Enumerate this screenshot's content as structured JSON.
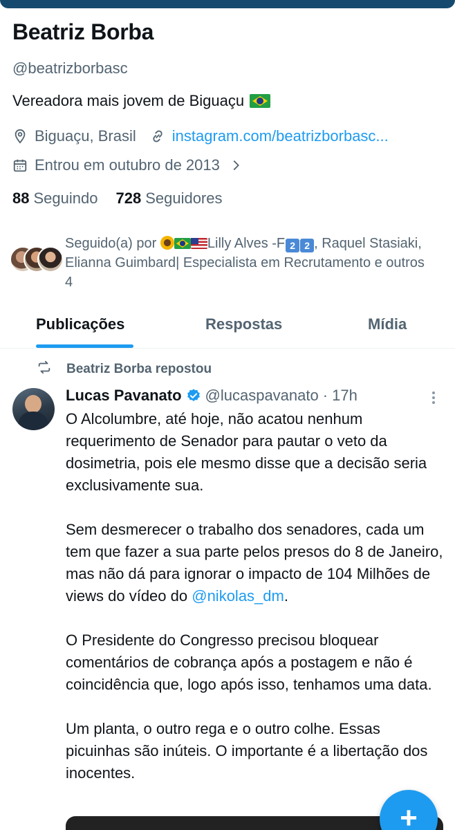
{
  "profile": {
    "name": "Beatriz Borba",
    "handle": "@beatrizborbasc",
    "bio": "Vereadora mais jovem de Biguaçu",
    "location": "Biguaçu, Brasil",
    "website": "instagram.com/beatrizborbasc...",
    "joined": "Entrou em outubro de 2013",
    "following_count": "88",
    "following_label": "Seguindo",
    "followers_count": "728",
    "followers_label": "Seguidores"
  },
  "followed_by": {
    "prefix": "Seguido(a) por",
    "name1": "Lilly Alves -F",
    "kbox": [
      "2",
      "2"
    ],
    "rest": ", Raquel Stasiaki, Elianna Guimbard| Especialista em Recrutamento e outros 4"
  },
  "tabs": [
    {
      "label": "Publicações",
      "active": true
    },
    {
      "label": "Respostas",
      "active": false
    },
    {
      "label": "Mídia",
      "active": false
    }
  ],
  "post": {
    "repost_text": "Beatriz Borba repostou",
    "author": "Lucas Pavanato",
    "handle": "@lucaspavanato",
    "time": "· 17h",
    "paragraphs": [
      "O Alcolumbre, até hoje, não acatou nenhum requerimento de Senador para pautar o veto da dosimetria, pois ele mesmo disse que a decisão seria exclusivamente sua.",
      "Sem desmerecer o trabalho dos senadores, cada um tem que fazer a sua parte pelos presos do 8 de Janeiro, mas não dá para ignorar o impacto de 104 Milhões de views do vídeo do",
      "O Presidente do Congresso precisou bloquear comentários de cobrança após a postagem e não é coincidência que, logo após isso, tenhamos uma data.",
      "Um planta, o outro rega e o outro colhe. Essas picuinhas são inúteis. O importante é a libertação dos inocentes."
    ],
    "mention": "@nikolas_dm",
    "mention_suffix": "."
  },
  "fab_label": "+",
  "colors": {
    "accent": "#1d9bf0",
    "muted": "#536471",
    "text": "#0f1419"
  }
}
